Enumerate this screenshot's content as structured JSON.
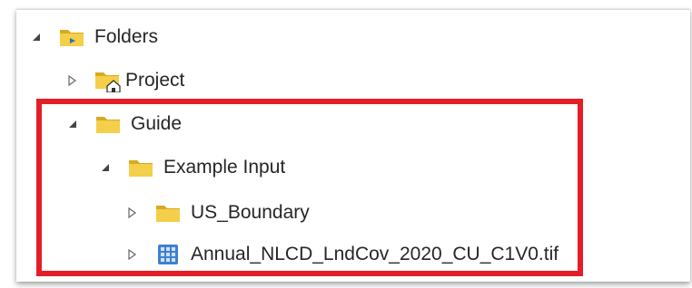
{
  "tree": {
    "folders": {
      "label": "Folders",
      "icon": "folder-icon",
      "expanded": true
    },
    "project": {
      "label": "Project",
      "icon": "home-folder-icon",
      "expanded": false
    },
    "guide": {
      "label": "Guide",
      "icon": "folder-icon",
      "expanded": true
    },
    "example_input": {
      "label": "Example Input",
      "icon": "folder-icon",
      "expanded": true
    },
    "us_boundary": {
      "label": "US_Boundary",
      "icon": "folder-icon",
      "expanded": false
    },
    "raster": {
      "label": "Annual_NLCD_LndCov_2020_CU_C1V0.tif",
      "icon": "raster-grid-icon",
      "expanded": false
    }
  },
  "colors": {
    "folder": "#e8c23a",
    "highlight": "#e41e26",
    "raster": "#3f7fd1"
  }
}
